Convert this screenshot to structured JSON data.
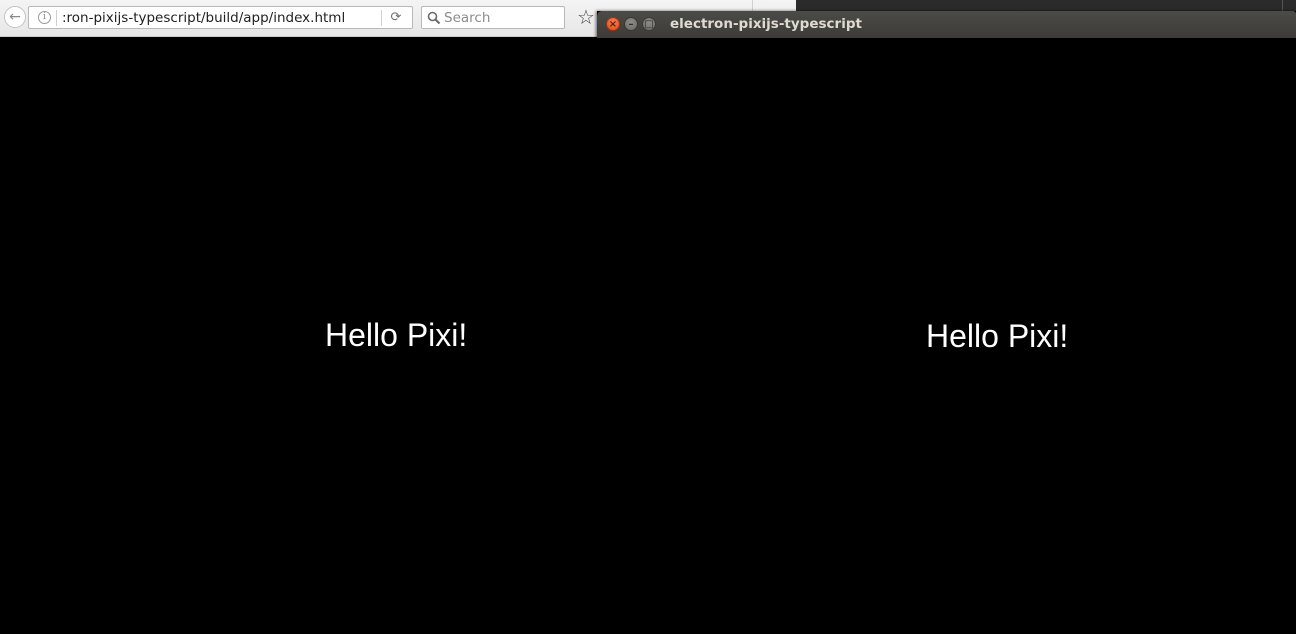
{
  "browser": {
    "url": ":ron-pixijs-typescript/build/app/index.html",
    "search_placeholder": "Search",
    "page_text": "Hello Pixi!"
  },
  "electron_window": {
    "title": "electron-pixijs-typescript",
    "page_text": "Hello Pixi!"
  },
  "icons": {
    "back": "back-arrow-icon",
    "info": "info-icon",
    "reload": "reload-icon",
    "search": "search-icon",
    "bookmark": "bookmark-star-icon",
    "close": "close-icon",
    "minimize": "minimize-icon",
    "maximize": "maximize-icon"
  },
  "colors": {
    "canvas_background": "#000000",
    "canvas_text": "#ffffff",
    "titlebar": "#3c3b37",
    "close_button": "#df4a16"
  }
}
